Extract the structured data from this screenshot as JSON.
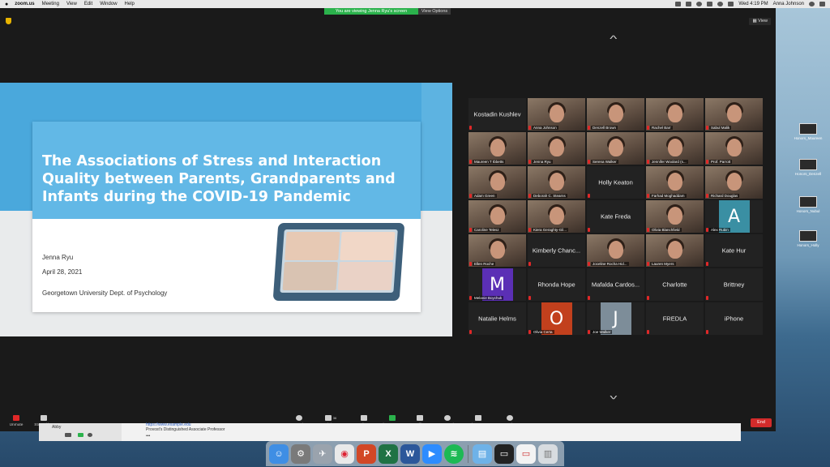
{
  "menubar": {
    "app": "zoom.us",
    "items": [
      "Meeting",
      "View",
      "Edit",
      "Window",
      "Help"
    ],
    "clock": "Wed 4:19 PM",
    "user": "Anna Johnson"
  },
  "banner": {
    "viewing": "You are viewing Jenna Ryu's screen",
    "options": "View Options"
  },
  "view_label": "View",
  "slide": {
    "title": "The Associations of Stress and Interaction Quality between Parents, Grandparents and Infants during the COVID-19 Pandemic",
    "author": "Jenna Ryu",
    "date": "April 28, 2021",
    "affiliation": "Georgetown University Dept. of Psychology"
  },
  "participants": [
    {
      "name": "Kostadin Kushlev",
      "video": false
    },
    {
      "name": "Anna Johnson",
      "video": true
    },
    {
      "name": "Denzell Brown",
      "video": true
    },
    {
      "name": "Rachel Barr",
      "video": true
    },
    {
      "name": "Sabul Malik",
      "video": true
    },
    {
      "name": "Maureen T Ibbetts",
      "video": true
    },
    {
      "name": "Jenna Ryu",
      "video": true
    },
    {
      "name": "Serena Walker",
      "video": true
    },
    {
      "name": "Jennifer Woolard (s...",
      "video": true
    },
    {
      "name": "Prof. Parrott",
      "video": true
    },
    {
      "name": "Adam Green",
      "video": true
    },
    {
      "name": "Deborah C. Stearns",
      "video": true
    },
    {
      "name": "Holly Keaton",
      "video": false
    },
    {
      "name": "Farhad Moghaddam",
      "video": true
    },
    {
      "name": "Richard Douglas",
      "video": true
    },
    {
      "name": "Caroline Telesz",
      "video": true
    },
    {
      "name": "Kiera Geraghty-Gil...",
      "video": true
    },
    {
      "name": "Kate Freda",
      "video": false
    },
    {
      "name": "Olivia Blanchfield",
      "video": true
    },
    {
      "name": "Alex Rubin",
      "video": false,
      "letter": "A",
      "color": "#3a8fa3"
    },
    {
      "name": "Ellen Roche",
      "video": true
    },
    {
      "name": "Kimberly Chanc...",
      "video": false
    },
    {
      "name": "Joceline Rocha Hid...",
      "video": true
    },
    {
      "name": "Lauren Myers",
      "video": true
    },
    {
      "name": "Kate Hur",
      "video": false
    },
    {
      "name": "Melanie Boychuk",
      "video": false,
      "letter": "M",
      "color": "#5b2fb5"
    },
    {
      "name": "Rhonda Hope",
      "video": false
    },
    {
      "name": "Mafalda Cardos...",
      "video": false
    },
    {
      "name": "Charlotte",
      "video": false
    },
    {
      "name": "Brittney",
      "video": false
    },
    {
      "name": "Natalie Helms",
      "video": false
    },
    {
      "name": "Olivia Certa",
      "video": false,
      "letter": "O",
      "color": "#c2401d"
    },
    {
      "name": "Joe Walker",
      "video": false,
      "letter": "J",
      "color": "#7d8d99"
    },
    {
      "name": "FREDLA",
      "video": false
    },
    {
      "name": "iPhone",
      "video": false
    }
  ],
  "toolbar": {
    "unmute": "Unmute",
    "stop_video": "Stop Video",
    "security": "Security",
    "participants": "Participants",
    "participants_count": "36",
    "chat": "Chat",
    "share_screen": "Share Screen",
    "polling": "Polling",
    "record": "Record",
    "breakout_rooms": "Breakout Rooms",
    "reactions": "Reactions",
    "end": "End"
  },
  "background_window": {
    "name": "Abby",
    "link": "https://www.example.edu",
    "line": "Provost's Distinguished Associate Professor"
  },
  "desktop_icons": [
    "Honors_Maureen",
    "Honors_Denzell",
    "Honors_Nubul",
    "Honors_Holly"
  ],
  "dock": [
    "Finder",
    "System Preferences",
    "Launchpad",
    "Chrome",
    "PowerPoint",
    "Excel",
    "Word",
    "Zoom",
    "Spotify",
    "Downloads",
    "Screenshots",
    "Documents",
    "Trash"
  ]
}
